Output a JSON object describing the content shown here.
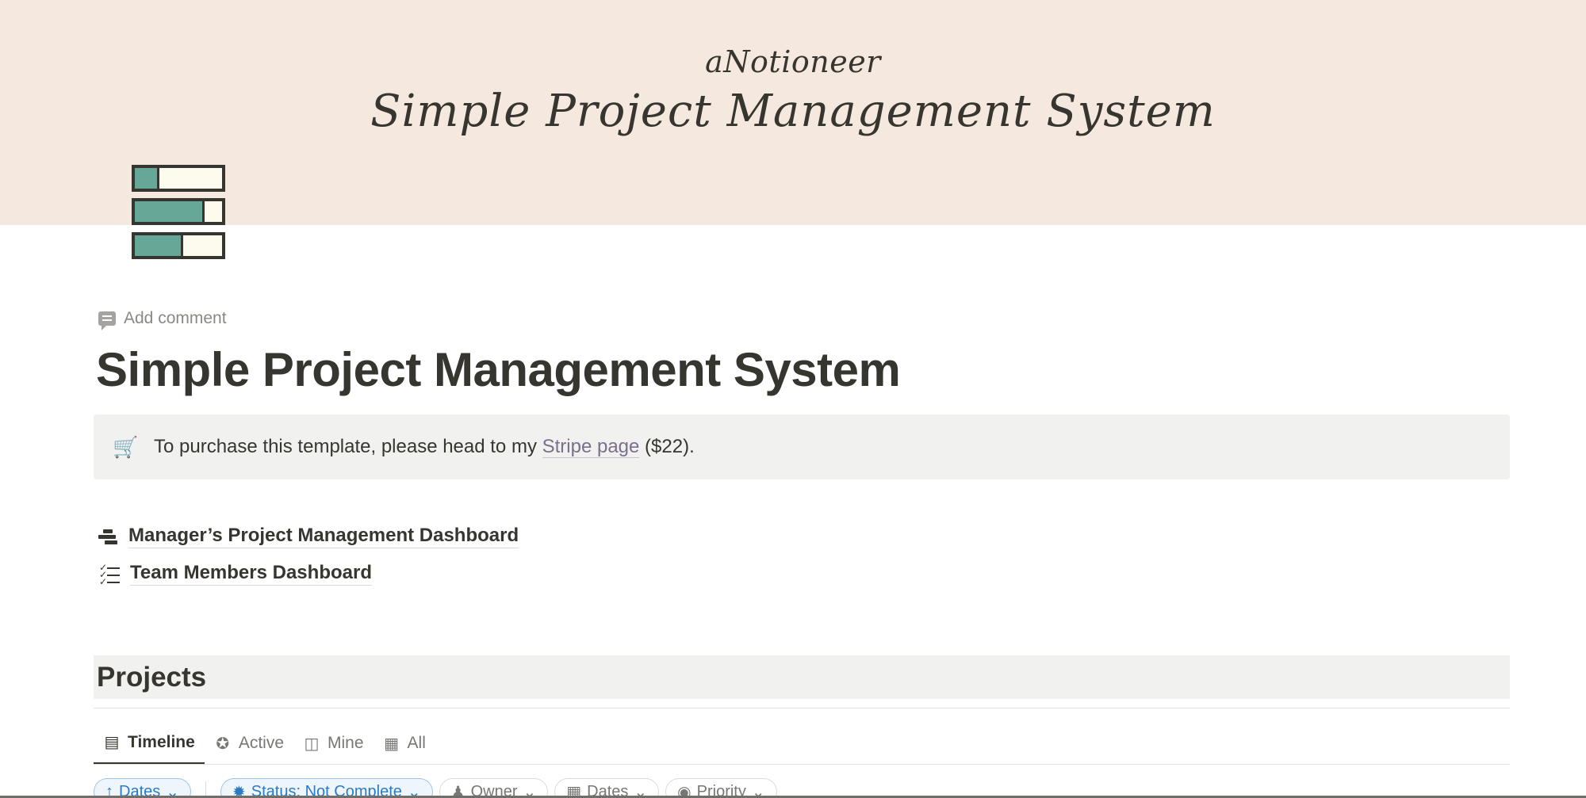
{
  "cover": {
    "brand": "aNotioneer",
    "title": "Simple Project Management System"
  },
  "page_icon": {
    "name": "progress-bars-icon",
    "progress": [
      0.28,
      0.8,
      0.55
    ],
    "fill_color": "#66a897"
  },
  "add_comment": "Add comment",
  "page_title": "Simple Project Management System",
  "callout": {
    "icon": "cart-icon",
    "text_before": "To purchase this template, please head to my ",
    "link": "Stripe page",
    "text_after": " ($22)."
  },
  "links": [
    {
      "icon": "gantt-icon",
      "label": "Manager’s Project Management Dashboard"
    },
    {
      "icon": "checklist-icon",
      "label": "Team Members Dashboard"
    }
  ],
  "projects": {
    "heading": "Projects",
    "tabs": [
      {
        "label": "Timeline",
        "icon": "timeline-icon",
        "active": true
      },
      {
        "label": "Active",
        "icon": "star-circle-icon",
        "active": false
      },
      {
        "label": "Mine",
        "icon": "board-icon",
        "active": false
      },
      {
        "label": "All",
        "icon": "table-icon",
        "active": false
      }
    ],
    "filters": {
      "sort": "Dates",
      "status": "Status: Not Complete",
      "owner": "Owner",
      "dates": "Dates",
      "priority": "Priority"
    }
  },
  "colors": {
    "cover_bg": "#f5e8de",
    "accent_blue": "#2b7bc4",
    "callout_bg": "#f1f1ef"
  }
}
